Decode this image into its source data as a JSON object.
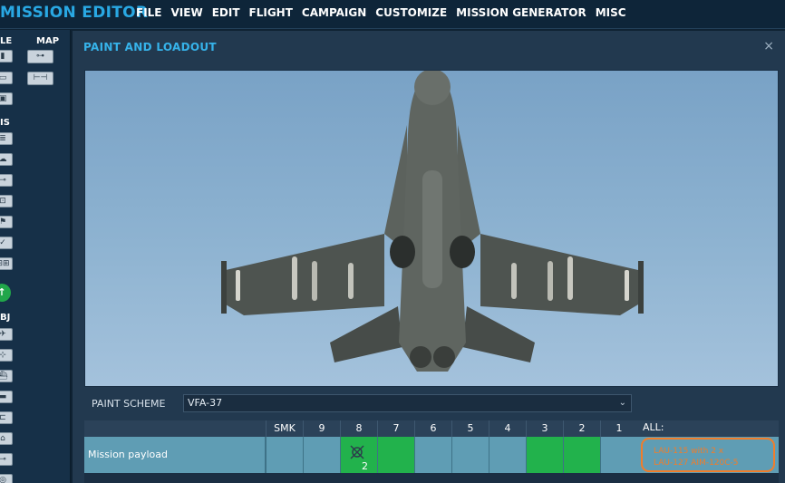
{
  "app": {
    "title": "MISSION EDITOR"
  },
  "menu": [
    "FILE",
    "VIEW",
    "EDIT",
    "FLIGHT",
    "CAMPAIGN",
    "CUSTOMIZE",
    "MISSION GENERATOR",
    "MISC"
  ],
  "left_panel": {
    "sections": {
      "file": "LE",
      "map": "MAP",
      "tools": "IS",
      "objects": "BJ"
    }
  },
  "dialog": {
    "title": "PAINT AND LOADOUT",
    "close": "×",
    "paint_scheme_label": "PAINT SCHEME",
    "paint_scheme_value": "VFA-37"
  },
  "pylon_table": {
    "columns": [
      "SMK",
      "9",
      "8",
      "7",
      "6",
      "5",
      "4",
      "3",
      "2",
      "1"
    ],
    "all_label": "ALL:",
    "row_label": "Mission payload",
    "filled_columns": [
      "8",
      "7",
      "3",
      "2"
    ],
    "pylon8_count": "2",
    "all_text": [
      "LAU-115 with 2 x",
      "LAU-127 AIM-120C-5"
    ]
  },
  "colors": {
    "accent": "#29a8e3",
    "highlight": "#f07d2b",
    "filled": "#22b24c"
  }
}
